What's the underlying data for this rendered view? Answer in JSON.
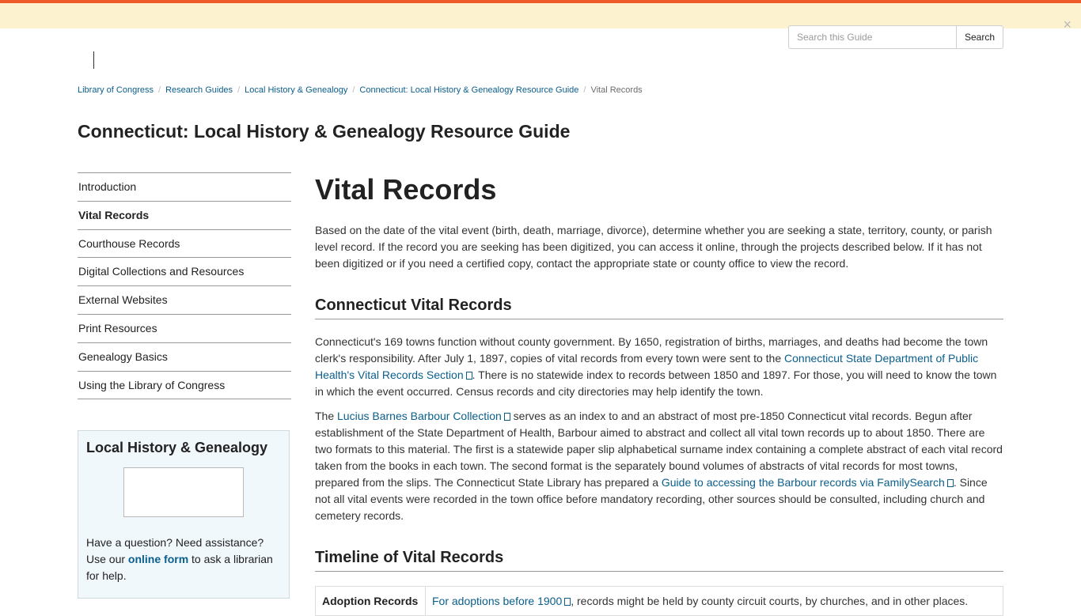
{
  "search": {
    "placeholder": "Search this Guide",
    "button_label": "Search"
  },
  "alert": {
    "close_glyph": "×"
  },
  "breadcrumb": [
    {
      "label": "Library of Congress"
    },
    {
      "label": "Research Guides"
    },
    {
      "label": "Local History & Genealogy"
    },
    {
      "label": "Connecticut: Local History & Genealogy Resource Guide"
    },
    {
      "label": "Vital Records"
    }
  ],
  "guide_title": "Connecticut: Local History & Genealogy Resource Guide",
  "sidebar": {
    "items": [
      {
        "label": "Introduction"
      },
      {
        "label": "Vital Records"
      },
      {
        "label": "Courthouse Records"
      },
      {
        "label": "Digital Collections and Resources"
      },
      {
        "label": "External Websites"
      },
      {
        "label": "Print Resources"
      },
      {
        "label": "Genealogy Basics"
      },
      {
        "label": "Using the Library of Congress"
      }
    ],
    "box": {
      "title": "Local History & Genealogy",
      "text_before": "Have a question? Need assistance? Use our ",
      "link_label": "online form",
      "text_after": " to ask a librarian for help."
    }
  },
  "main": {
    "title": "Vital Records",
    "intro": "Based on the date of the vital event (birth, death, marriage, divorce), determine whether you are seeking a state, territory, county, or parish level record. If the record you are seeking has been digitized, you can access it online, through the projects described below. If it has not been digitized or if you need a certified copy, contact the appropriate state or county office to view the record.",
    "section1": {
      "heading": "Connecticut Vital Records",
      "p1_a": "Connecticut's 169 towns function without county government. By 1650, registration of births, marriages, and deaths had become the town clerk's responsibility. After July 1, 1897, copies of vital records from every town were sent to the ",
      "p1_link": "Connecticut State Department of Public Health's Vital Records Section",
      "p1_b": ". There is no statewide index to records between 1850 and 1897. For those, you will need to know the town in which the event occurred. Census records and city directories may help identify the town.",
      "p2_a": "The ",
      "p2_link1": "Lucius Barnes Barbour Collection",
      "p2_b": " serves as an index to and an abstract of most pre-1850 Connecticut vital records. Begun after establishment of the State Department of Health, Barbour aimed to abstract and collect all vital town records up to about 1850. There are two formats to this material. The first is a statewide paper slip alphabetical surname index containing a complete abstract of each vital record taken from the books in each town. The second format is the separately bound volumes of abstracts of vital records for most towns, prepared from the slips. The Connecticut State Library has prepared a ",
      "p2_link2": "Guide to accessing the Barbour records via FamilySearch",
      "p2_c": ". Since not all vital events were recorded in the town office before mandatory recording, other sources should be consulted, including church and cemetery records."
    },
    "section2": {
      "heading": "Timeline of Vital Records",
      "rows": [
        {
          "label": "Adoption Records",
          "link": "For adoptions before 1900",
          "text": ", records might be held by county circuit courts, by churches, and in other places."
        }
      ]
    }
  }
}
